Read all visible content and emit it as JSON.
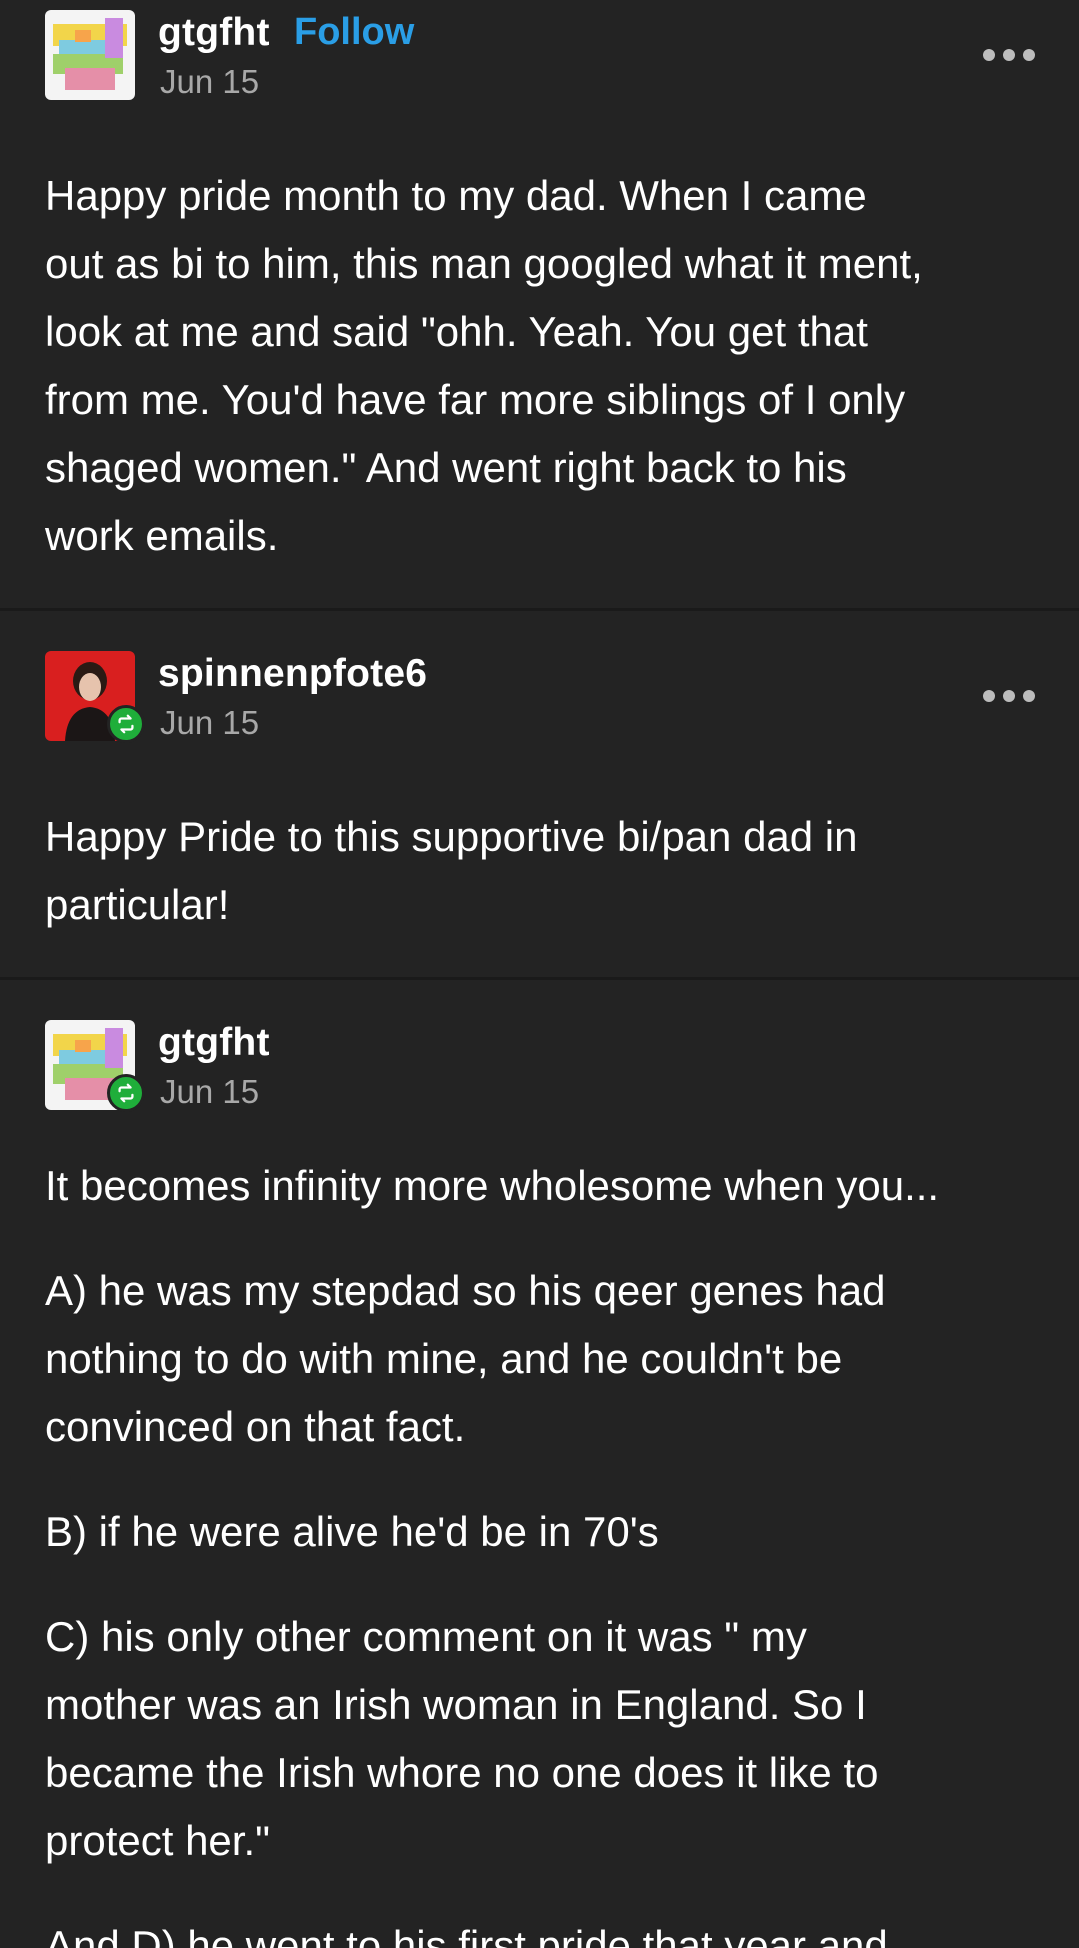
{
  "posts": [
    {
      "username": "gtgfht",
      "follow_label": "Follow",
      "date": "Jun 15",
      "body_lines": [
        "Happy pride month to my dad. When I came",
        "out as bi to him, this man googled what it ment,",
        "look at me and said \"ohh. Yeah. You get that",
        "from me. You'd have far more siblings of I only",
        "shaged women.\" And went right back to his",
        "work emails."
      ]
    },
    {
      "username": "spinnenpfote6",
      "date": "Jun 15",
      "reblogged": true,
      "body_lines": [
        "Happy Pride to this supportive bi/pan dad in",
        "particular!"
      ]
    },
    {
      "username": "gtgfht",
      "date": "Jun 15",
      "reblogged": true,
      "paragraphs": [
        [
          "It becomes infinity more wholesome when you..."
        ],
        [
          "A) he was my stepdad so his qeer genes had",
          "nothing to do with mine, and he couldn't be",
          "convinced on that fact."
        ],
        [
          "B) if he were alive he'd be in 70's"
        ],
        [
          "C) his only other comment on it was \" my",
          "mother was an Irish woman in England. So I",
          "became the Irish whore no one does it like to",
          "protect her.\""
        ],
        [
          "And D) he went to his first pride that year and"
        ]
      ]
    }
  ],
  "icons": {
    "more": "more-options-icon",
    "reblog": "reblog-icon"
  },
  "colors": {
    "background": "#232323",
    "follow": "#2a9ee6",
    "reblog_badge": "#1fae3a",
    "date": "#a8a8a8"
  }
}
